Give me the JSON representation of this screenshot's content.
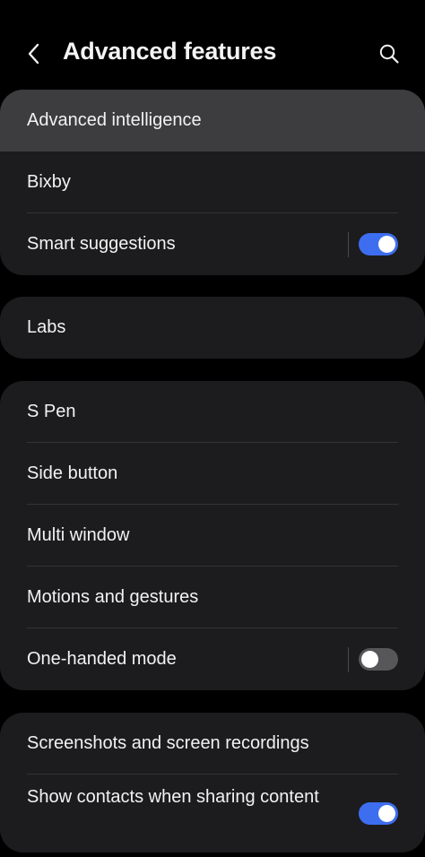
{
  "header": {
    "back_icon": "chevron-left-icon",
    "title": "Advanced features",
    "search_icon": "search-icon"
  },
  "group1": {
    "items": [
      {
        "label": "Advanced intelligence"
      },
      {
        "label": "Bixby"
      },
      {
        "label": "Smart suggestions",
        "toggle": true
      }
    ]
  },
  "group2": {
    "items": [
      {
        "label": "Labs"
      }
    ]
  },
  "group3": {
    "items": [
      {
        "label": "S Pen"
      },
      {
        "label": "Side button"
      },
      {
        "label": "Multi window"
      },
      {
        "label": "Motions and gestures"
      },
      {
        "label": "One-handed mode",
        "toggle": false
      }
    ]
  },
  "group4": {
    "items": [
      {
        "label": "Screenshots and screen recordings"
      },
      {
        "label": "Show contacts when sharing content",
        "toggle": true
      }
    ]
  },
  "colors": {
    "background": "#000000",
    "card": "#1c1c1e",
    "toggle_on": "#3e6ef0",
    "toggle_off": "#57575a"
  }
}
